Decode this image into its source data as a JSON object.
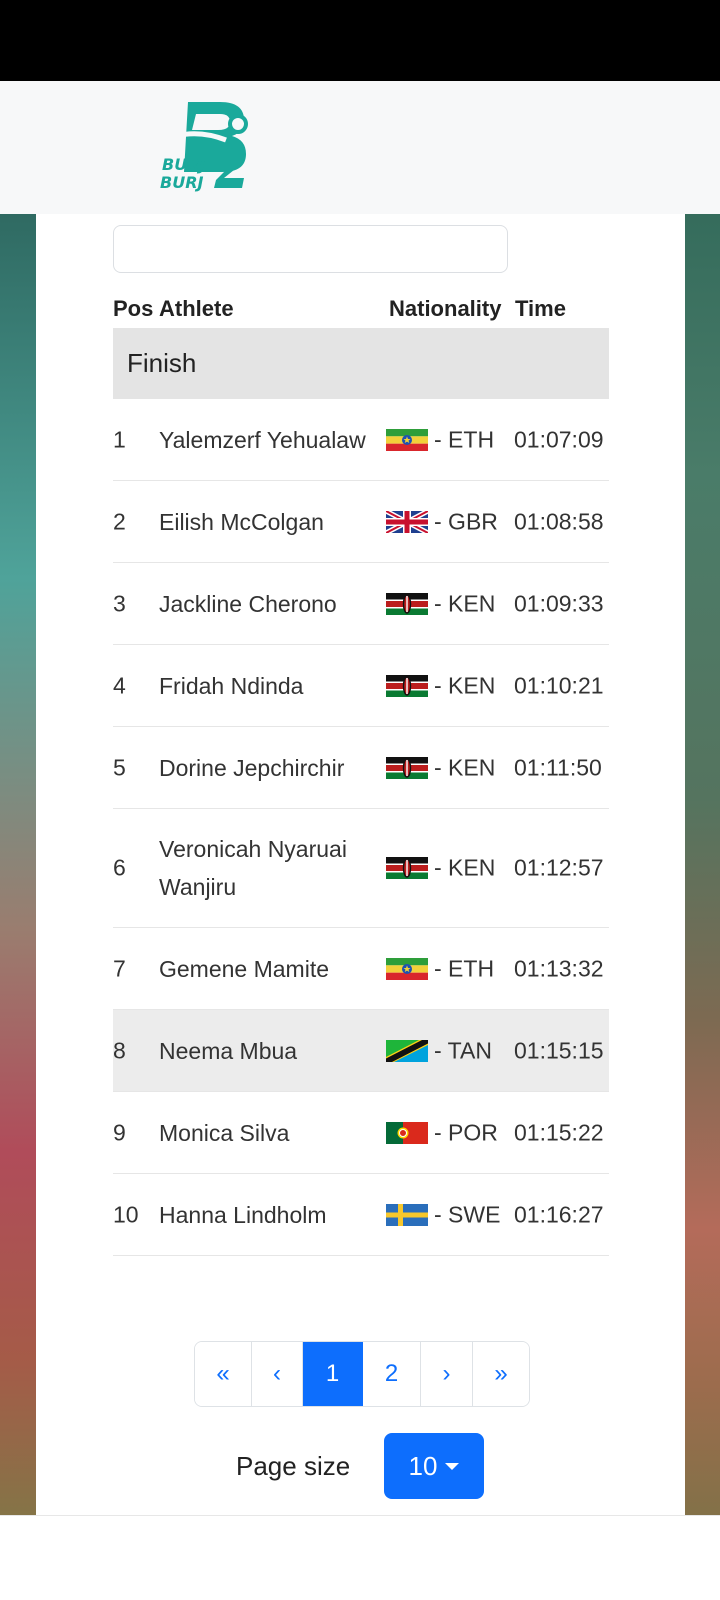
{
  "brand": {
    "logo_text": "BURJ2 BURJ",
    "colors": {
      "primary": "#1aa99b",
      "accent": "#0d6efd"
    }
  },
  "search": {
    "placeholder": "",
    "value": ""
  },
  "table": {
    "headers": {
      "pos": "Pos",
      "athlete": "Athlete",
      "nationality": "Nationality",
      "time": "Time"
    },
    "group_label": "Finish",
    "rows": [
      {
        "pos": "1",
        "name": "Yalemzerf Yehualaw",
        "flag": "ethiopia-flag-icon",
        "nat": "- ETH",
        "time": "01:07:09"
      },
      {
        "pos": "2",
        "name": "Eilish McColgan",
        "flag": "uk-flag-icon",
        "nat": "- GBR",
        "time": "01:08:58"
      },
      {
        "pos": "3",
        "name": "Jackline Cherono",
        "flag": "kenya-flag-icon",
        "nat": "- KEN",
        "time": "01:09:33"
      },
      {
        "pos": "4",
        "name": "Fridah Ndinda",
        "flag": "kenya-flag-icon",
        "nat": "- KEN",
        "time": "01:10:21"
      },
      {
        "pos": "5",
        "name": "Dorine Jepchirchir",
        "flag": "kenya-flag-icon",
        "nat": "- KEN",
        "time": "01:11:50"
      },
      {
        "pos": "6",
        "name": "Veronicah Nyaruai Wanjiru",
        "flag": "kenya-flag-icon",
        "nat": "- KEN",
        "time": "01:12:57"
      },
      {
        "pos": "7",
        "name": "Gemene Mamite",
        "flag": "ethiopia-flag-icon",
        "nat": "- ETH",
        "time": "01:13:32"
      },
      {
        "pos": "8",
        "name": "Neema Mbua",
        "flag": "tanzania-flag-icon",
        "nat": "- TAN",
        "time": "01:15:15"
      },
      {
        "pos": "9",
        "name": "Monica Silva",
        "flag": "portugal-flag-icon",
        "nat": "- POR",
        "time": "01:15:22"
      },
      {
        "pos": "10",
        "name": "Hanna Lindholm",
        "flag": "sweden-flag-icon",
        "nat": "- SWE",
        "time": "01:16:27"
      }
    ]
  },
  "pagination": {
    "first": "«",
    "prev": "‹",
    "pages": [
      "1",
      "2"
    ],
    "active_page": "1",
    "next": "›",
    "last": "»"
  },
  "page_size": {
    "label": "Page size",
    "value": "10"
  }
}
